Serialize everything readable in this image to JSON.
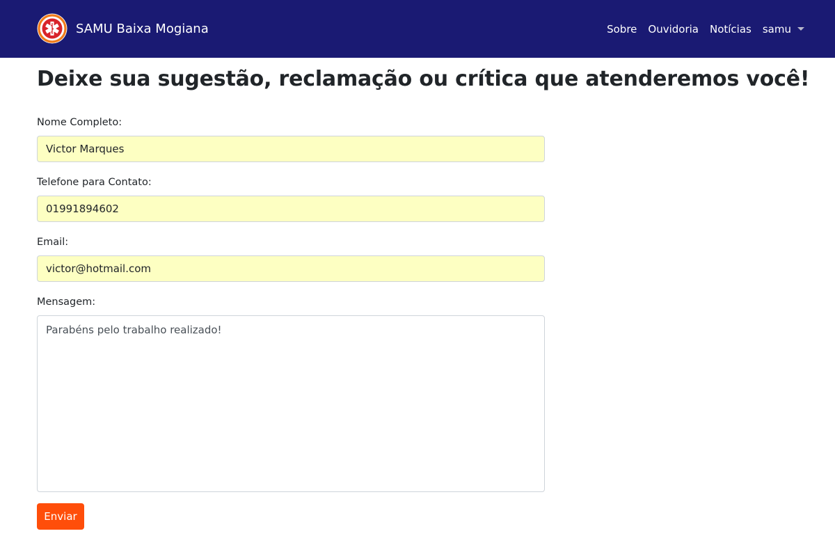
{
  "header": {
    "brand_name": "SAMU Baixa Mogiana",
    "logo_icon": "samu-star-of-life-icon",
    "brand_color": "#1a1a73",
    "nav": [
      {
        "label": "Sobre"
      },
      {
        "label": "Ouvidoria"
      },
      {
        "label": "Notícias"
      }
    ],
    "user_menu": {
      "label": "samu",
      "icon": "caret-down-icon"
    }
  },
  "main": {
    "title": "Deixe sua sugestão, reclamação ou crítica que atenderemos você!",
    "form": {
      "name": {
        "label": "Nome Completo:",
        "value": "Victor Marques"
      },
      "phone": {
        "label": "Telefone para Contato:",
        "value": "01991894602"
      },
      "email": {
        "label": "Email:",
        "value": "victor@hotmail.com"
      },
      "message": {
        "label": "Mensagem:",
        "value": "Parabéns pelo trabalho realizado!"
      },
      "submit_label": "Enviar",
      "submit_color": "#ff4e0a",
      "autofill_color": "#fdffc2"
    }
  }
}
